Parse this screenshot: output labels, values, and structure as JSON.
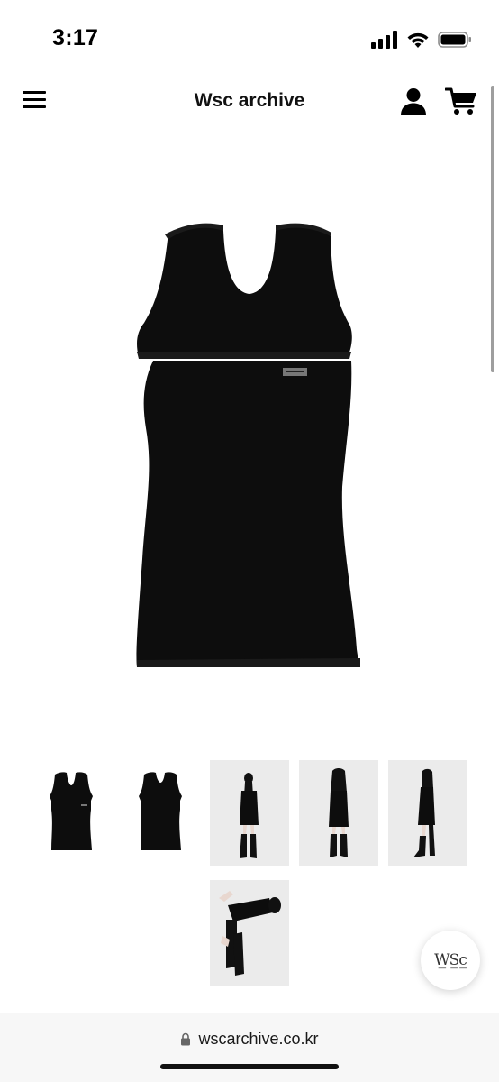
{
  "status_bar": {
    "time": "3:17"
  },
  "nav": {
    "brand": "Wsc archive",
    "menu_icon": "hamburger-menu-icon",
    "account_icon": "user-icon",
    "cart_icon": "shopping-cart-icon"
  },
  "product": {
    "main_image": "black sleeveless mini dress with side cut-outs"
  },
  "thumbnails": [
    {
      "desc": "dress front view"
    },
    {
      "desc": "dress back view"
    },
    {
      "desc": "model front pose"
    },
    {
      "desc": "model back pose"
    },
    {
      "desc": "model side pose"
    },
    {
      "desc": "model lying pose"
    }
  ],
  "floating_button": {
    "label": "W̲S̲c̲"
  },
  "browser": {
    "url": "wscarchive.co.kr",
    "lock_icon": "lock-icon"
  },
  "colors": {
    "garment": "#0d0d0d",
    "photo_bg": "#e9e9e9",
    "browser_bg": "#f7f7f7"
  }
}
